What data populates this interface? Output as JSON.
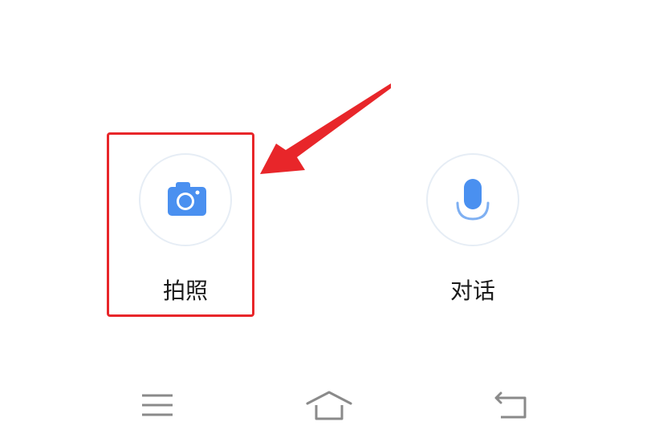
{
  "actions": {
    "photo": {
      "label": "拍照",
      "icon": "camera-icon"
    },
    "voice": {
      "label": "对话",
      "icon": "microphone-icon"
    }
  },
  "colors": {
    "accent": "#4a90f0",
    "highlight": "#e8262a",
    "nav_icon": "#8a8a8a"
  },
  "nav": {
    "menu_icon": "menu-icon",
    "home_icon": "home-icon",
    "back_icon": "back-icon"
  }
}
